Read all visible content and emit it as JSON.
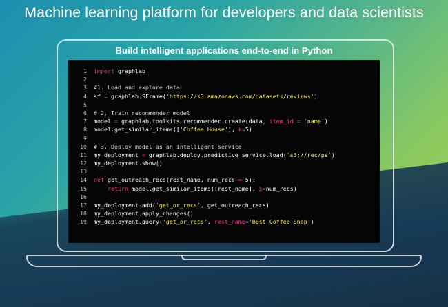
{
  "headline": "Machine learning platform for developers and data scientists",
  "subheadline": "Build intelligent applications end-to-end in Python",
  "code": [
    {
      "n": "1",
      "tokens": [
        {
          "t": "import",
          "c": "kw"
        },
        {
          "t": " graphlab",
          "c": "plain"
        }
      ]
    },
    {
      "n": "2",
      "tokens": []
    },
    {
      "n": "3",
      "tokens": [
        {
          "t": "#1. Load and explore data",
          "c": "cmt"
        }
      ]
    },
    {
      "n": "4",
      "tokens": [
        {
          "t": "sf ",
          "c": "plain"
        },
        {
          "t": "=",
          "c": "kw"
        },
        {
          "t": " graphlab.SFrame(",
          "c": "plain"
        },
        {
          "t": "'https://s3.amazonaws.com/datasets/reviews'",
          "c": "str"
        },
        {
          "t": ")",
          "c": "plain"
        }
      ]
    },
    {
      "n": "5",
      "tokens": []
    },
    {
      "n": "6",
      "tokens": [
        {
          "t": "# 2. Train recommender model",
          "c": "cmt"
        }
      ]
    },
    {
      "n": "7",
      "tokens": [
        {
          "t": "model ",
          "c": "plain"
        },
        {
          "t": "=",
          "c": "kw"
        },
        {
          "t": " graphlab.toolkits.recommender.create(data, ",
          "c": "plain"
        },
        {
          "t": "item_id",
          "c": "arg"
        },
        {
          "t": " ",
          "c": "plain"
        },
        {
          "t": "=",
          "c": "kw"
        },
        {
          "t": " ",
          "c": "plain"
        },
        {
          "t": "'name'",
          "c": "str"
        },
        {
          "t": ")",
          "c": "plain"
        }
      ]
    },
    {
      "n": "8",
      "tokens": [
        {
          "t": "model.get_similar_items([",
          "c": "plain"
        },
        {
          "t": "'Coffee House'",
          "c": "str"
        },
        {
          "t": "], ",
          "c": "plain"
        },
        {
          "t": "k",
          "c": "arg"
        },
        {
          "t": "=",
          "c": "kw"
        },
        {
          "t": "5)",
          "c": "plain"
        }
      ]
    },
    {
      "n": "9",
      "tokens": []
    },
    {
      "n": "10",
      "tokens": [
        {
          "t": "# 3. Deploy model as an intelligent service",
          "c": "cmt"
        }
      ]
    },
    {
      "n": "11",
      "tokens": [
        {
          "t": "my_deployment ",
          "c": "plain"
        },
        {
          "t": "=",
          "c": "kw"
        },
        {
          "t": " graphlab.deploy.predictive_service.load(",
          "c": "plain"
        },
        {
          "t": "'s3://rec/ps'",
          "c": "str"
        },
        {
          "t": ")",
          "c": "plain"
        }
      ]
    },
    {
      "n": "12",
      "tokens": [
        {
          "t": "my_deployment.show()",
          "c": "plain"
        }
      ]
    },
    {
      "n": "13",
      "tokens": []
    },
    {
      "n": "14",
      "tokens": [
        {
          "t": "def",
          "c": "kw"
        },
        {
          "t": " get_outreach_recs(rest_name, num_recs ",
          "c": "plain"
        },
        {
          "t": "=",
          "c": "kw"
        },
        {
          "t": " 5):",
          "c": "plain"
        }
      ]
    },
    {
      "n": "15",
      "tokens": [
        {
          "t": "    ",
          "c": "plain"
        },
        {
          "t": "return",
          "c": "kw"
        },
        {
          "t": " model.get_similar_items([rest_name], ",
          "c": "plain"
        },
        {
          "t": "k",
          "c": "arg"
        },
        {
          "t": "=",
          "c": "kw"
        },
        {
          "t": "num_recs)",
          "c": "plain"
        }
      ]
    },
    {
      "n": "16",
      "tokens": []
    },
    {
      "n": "17",
      "tokens": [
        {
          "t": "my_deployment.add(",
          "c": "plain"
        },
        {
          "t": "'get_or_recs'",
          "c": "str"
        },
        {
          "t": ", get_outreach_recs)",
          "c": "plain"
        }
      ]
    },
    {
      "n": "18",
      "tokens": [
        {
          "t": "my_deployment.apply_changes()",
          "c": "plain"
        }
      ]
    },
    {
      "n": "19",
      "tokens": [
        {
          "t": "my_deployment.query(",
          "c": "plain"
        },
        {
          "t": "'get_or_recs'",
          "c": "str"
        },
        {
          "t": ", ",
          "c": "plain"
        },
        {
          "t": "rest_name",
          "c": "arg"
        },
        {
          "t": "=",
          "c": "kw"
        },
        {
          "t": "'Best Coffee Shop'",
          "c": "str"
        },
        {
          "t": ")",
          "c": "plain"
        }
      ]
    }
  ],
  "colors": {
    "keyword": "#e83e8c",
    "string": "#f5f25a",
    "comment": "#d8d8d8",
    "plain": "#ffffff"
  }
}
